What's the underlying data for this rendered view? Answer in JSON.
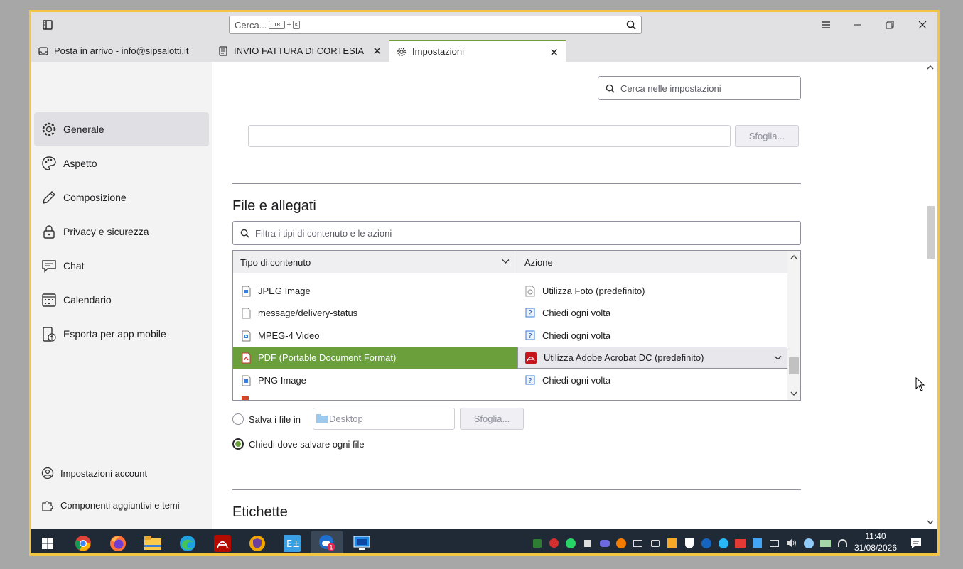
{
  "titlebar": {
    "search_placeholder": "Cerca...",
    "search_kbd_ctrl": "CTRL",
    "search_kbd_plus": "+",
    "search_kbd_k": "K"
  },
  "tabs": [
    {
      "label": "Posta in arrivo - info@sipsalotti.it",
      "icon": "inbox-icon"
    },
    {
      "label": "INVIO FATTURA DI CORTESIA",
      "icon": "message-icon",
      "close": "✕"
    },
    {
      "label": "Impostazioni",
      "icon": "gear-icon",
      "close": "✕",
      "active": true
    }
  ],
  "sidebar": {
    "items": [
      {
        "label": "Generale",
        "icon": "gear-icon",
        "selected": true
      },
      {
        "label": "Aspetto",
        "icon": "palette-icon"
      },
      {
        "label": "Composizione",
        "icon": "pencil-icon"
      },
      {
        "label": "Privacy e sicurezza",
        "icon": "lock-icon"
      },
      {
        "label": "Chat",
        "icon": "chat-icon"
      },
      {
        "label": "Calendario",
        "icon": "calendar-icon"
      },
      {
        "label": "Esporta per app mobile",
        "icon": "mobile-export-icon"
      }
    ],
    "bottom": [
      {
        "label": "Impostazioni account",
        "icon": "account-icon"
      },
      {
        "label": "Componenti aggiuntivi e temi",
        "icon": "puzzle-icon"
      }
    ]
  },
  "settings": {
    "search_placeholder": "Cerca nelle impostazioni",
    "browse_label": "Sfoglia...",
    "section_files": "File e allegati",
    "filter_placeholder": "Filtra i tipi di contenuto e le azioni",
    "col_type": "Tipo di contenuto",
    "col_action": "Azione",
    "rows": [
      {
        "type": "JPEG Image",
        "action": "Utilizza Foto (predefinito)"
      },
      {
        "type": "message/delivery-status",
        "action": "Chiedi ogni volta"
      },
      {
        "type": "MPEG-4 Video",
        "action": "Chiedi ogni volta"
      },
      {
        "type": "PDF (Portable Document Format)",
        "action": "Utilizza Adobe Acrobat DC (predefinito)",
        "selected": true
      },
      {
        "type": "PNG Image",
        "action": "Chiedi ogni volta"
      }
    ],
    "save_files_label": "Salva i file in",
    "save_folder": "Desktop",
    "save_browse_label": "Sfoglia...",
    "ask_where_label": "Chiedi dove salvare ogni file",
    "section_tags": "Etichette"
  },
  "taskbar": {
    "time": "11:40",
    "date": "31/08/2026",
    "thunderbird_badge": "1"
  },
  "colors": {
    "accent": "#6a9f3c",
    "frame_border": "#f4c542",
    "taskbar": "#1f2a36"
  }
}
